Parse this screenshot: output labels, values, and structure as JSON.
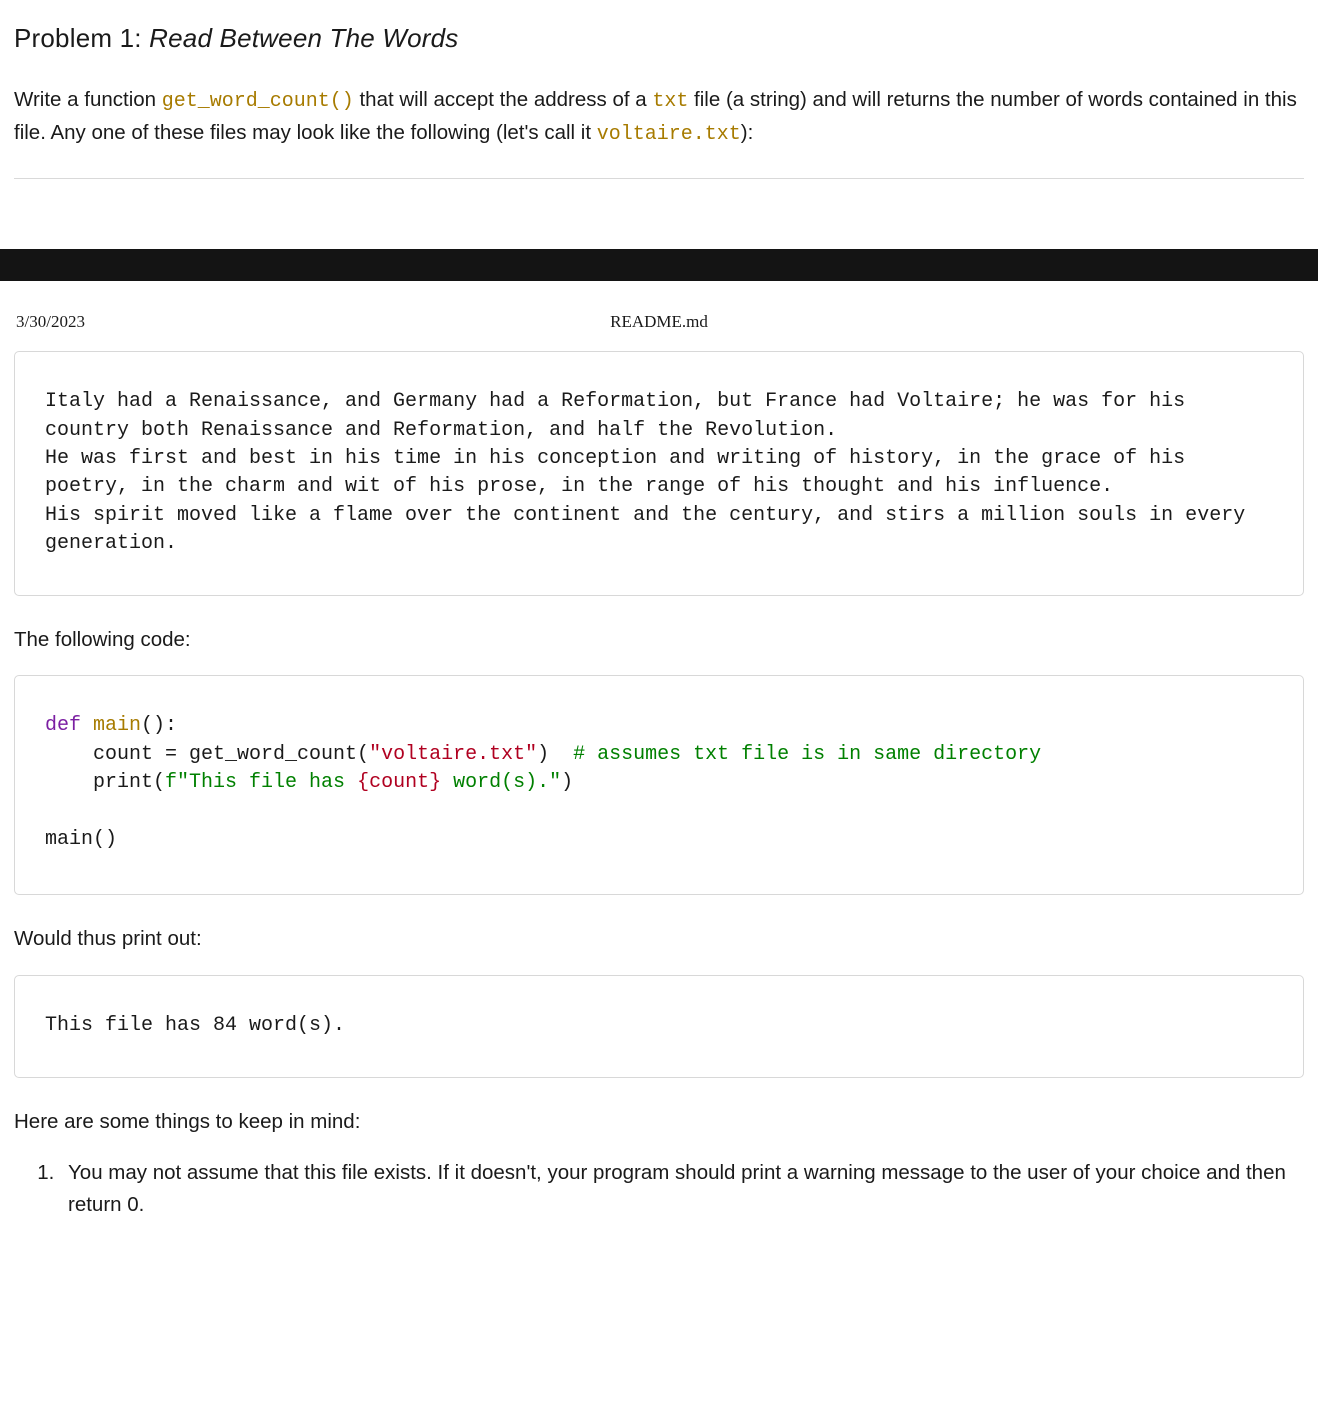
{
  "title": {
    "label": "Problem 1:",
    "name": "Read Between The Words"
  },
  "intro": {
    "t1": "Write a function ",
    "code1": "get_word_count()",
    "t2": " that will accept the address of a ",
    "code2": "txt",
    "t3": " file (a string) and will returns the number of words contained in this file. Any one of these files may look like the following (let's call it ",
    "code3": "voltaire.txt",
    "t4": "):"
  },
  "header": {
    "date": "3/30/2023",
    "readme": "README.md"
  },
  "sample_text": "Italy had a Renaissance, and Germany had a Reformation, but France had Voltaire; he was for his country both Renaissance and Reformation, and half the Revolution.\nHe was first and best in his time in his conception and writing of history, in the grace of his poetry, in the charm and wit of his prose, in the range of his thought and his influence.\nHis spirit moved like a flame over the continent and the century, and stirs a million souls in every generation.",
  "para_following": "The following code:",
  "code": {
    "l1_kw": "def",
    "l1_fn": " main",
    "l1_rest": "():",
    "l2_a": "    count = get_word_count(",
    "l2_str": "\"voltaire.txt\"",
    "l2_b": ")  ",
    "l2_cmt": "# assumes txt file is in same directory",
    "l3_a": "    print(",
    "l3_f": "f\"This file has ",
    "l3_interp": "{count}",
    "l3_f2": " word(s).\"",
    "l3_b": ")",
    "l5": "main()"
  },
  "para_would": "Would thus print out:",
  "output": "This file has 84 word(s).",
  "para_notes": "Here are some things to keep in mind:",
  "notes": {
    "n1": "You may not assume that this file exists. If it doesn't, your program should print a warning message to the user of your choice and then return 0."
  }
}
